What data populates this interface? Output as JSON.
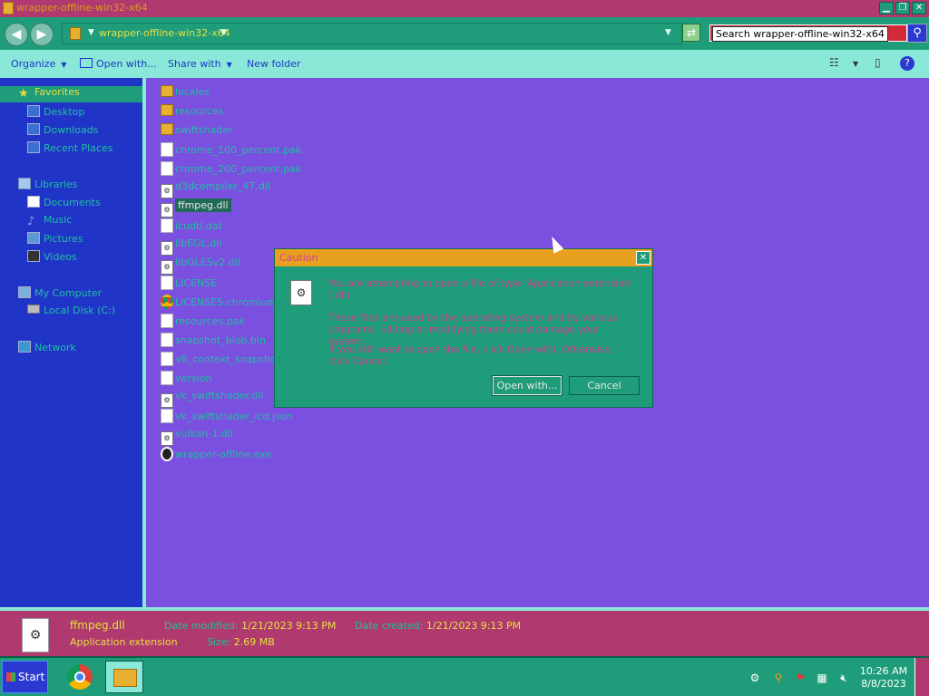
{
  "window": {
    "title": "wrapper-offline-win32-x64",
    "minimize_glyph": "▁",
    "restore_glyph": "❐",
    "close_glyph": "✕"
  },
  "address": {
    "back_glyph": "◀",
    "forward_glyph": "▶",
    "path_crumb": "wrapper-offline-win32-x64",
    "refresh_glyph": "⇄",
    "search_placeholder": "Search wrapper-offline-win32-x64",
    "search_glyph": "⚲"
  },
  "toolbar": {
    "organize": "Organize",
    "open_with": "Open with...",
    "share_with": "Share with",
    "new_folder": "New folder",
    "dropdown_glyph": "▼",
    "views_glyph": "☷",
    "preview_glyph": "▯",
    "help_glyph": "?"
  },
  "sidebar": {
    "favorites": "Favorites",
    "desktop": "Desktop",
    "downloads": "Downloads",
    "recent_places": "Recent Places",
    "libraries": "Libraries",
    "documents": "Documents",
    "music": "Music",
    "pictures": "Pictures",
    "videos": "Videos",
    "my_computer": "My Computer",
    "local_disk": "Local Disk (C:)",
    "network": "Network"
  },
  "files": [
    {
      "name": "locales",
      "icon": "folder-icon"
    },
    {
      "name": "resources",
      "icon": "folder-icon"
    },
    {
      "name": "swiftshader",
      "icon": "folder-icon"
    },
    {
      "name": "chrome_100_percent.pak",
      "icon": "document-icon"
    },
    {
      "name": "chrome_200_percent.pak",
      "icon": "document-icon"
    },
    {
      "name": "d3dcompiler_47.dll",
      "icon": "dll-icon"
    },
    {
      "name": "ffmpeg.dll",
      "icon": "dll-icon"
    },
    {
      "name": "icudtl.dat",
      "icon": "document-icon"
    },
    {
      "name": "libEGL.dll",
      "icon": "dll-icon"
    },
    {
      "name": "libGLESv2.dll",
      "icon": "dll-icon"
    },
    {
      "name": "LICENSE",
      "icon": "document-icon"
    },
    {
      "name": "LICENSES.chromium.ht",
      "icon": "chrome-icon"
    },
    {
      "name": "resources.pak",
      "icon": "document-icon"
    },
    {
      "name": "snapshot_blob.bin",
      "icon": "document-icon"
    },
    {
      "name": "v8_context_snapshot.",
      "icon": "document-icon"
    },
    {
      "name": "version",
      "icon": "document-icon"
    },
    {
      "name": "vk_swiftshader.dll",
      "icon": "dll-icon"
    },
    {
      "name": "vk_swiftshader_icd.json",
      "icon": "document-icon"
    },
    {
      "name": "vulkan-1.dll",
      "icon": "dll-icon"
    },
    {
      "name": "wrapper-offline.exe",
      "icon": "exe-icon"
    }
  ],
  "dialog": {
    "title": "Caution",
    "close_glyph": "✕",
    "message": "You are attempting to open a file of type 'Application extension' (.dll)",
    "warning": "These files are used by the operating system and by various programs. Editing or modifying them could damage your system.",
    "instruction": "If you still want to open the file, click Open with. Otherwise, click Cancel.",
    "open_with_button": "Open with...",
    "cancel_button": "Cancel"
  },
  "details": {
    "file_name": "ffmpeg.dll",
    "file_type": "Application extension",
    "date_modified_label": "Date modified:",
    "date_modified": "1/21/2023 9:13 PM",
    "date_created_label": "Date created:",
    "date_created": "1/21/2023 9:13 PM",
    "size_label": "Size:",
    "size": "2.69 MB"
  },
  "taskbar": {
    "start": "Start",
    "time": "10:26 AM",
    "date": "8/8/2023"
  }
}
